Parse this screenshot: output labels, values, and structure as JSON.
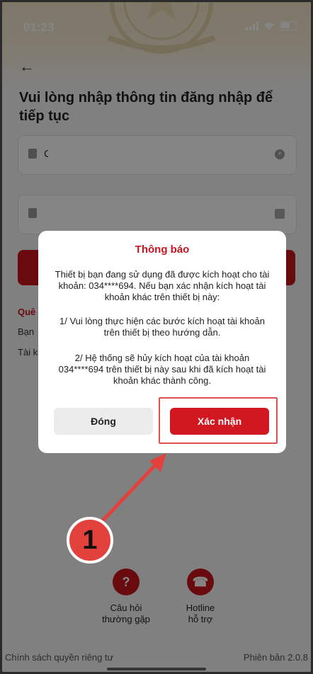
{
  "status_bar": {
    "time": "01:23"
  },
  "page": {
    "title": "Vui lòng nhập thông tin đăng nhập để tiếp tục",
    "username_value": "C",
    "section_title": "Quê",
    "line1": "Bạn",
    "line2": "Tài k"
  },
  "modal": {
    "title": "Thông báo",
    "para1": "Thiết bị bạn đang sử dụng đã được kích hoạt cho tài khoản: 034****694. Nếu bạn xác nhận kích hoạt tài khoản khác trên thiết bị này:",
    "para2": "1/ Vui lòng thực hiện các bước kích hoạt tài khoản trên thiết bị theo hướng dẫn.",
    "para3": "2/ Hệ thống sẽ hủy kích hoạt của tài khoản 034****694 trên thiết bị này sau khi đã kích hoạt tài khoản khác thành công.",
    "close_label": "Đóng",
    "confirm_label": "Xác nhận"
  },
  "annotation": {
    "step_number": "1"
  },
  "footer": {
    "faq_line1": "Câu hỏi",
    "faq_line2": "thường gặp",
    "hotline_line1": "Hotline",
    "hotline_line2": "hỗ trợ",
    "privacy": "Chính sách quyền riêng tư",
    "version": "Phiên bản 2.0.8"
  },
  "colors": {
    "brand_red": "#c9151e",
    "annotation_red": "#e3413c"
  },
  "icons": [
    "back-arrow-icon",
    "id-card-icon",
    "clear-icon",
    "lock-icon",
    "eye-off-icon",
    "question-icon",
    "support-agent-icon"
  ]
}
